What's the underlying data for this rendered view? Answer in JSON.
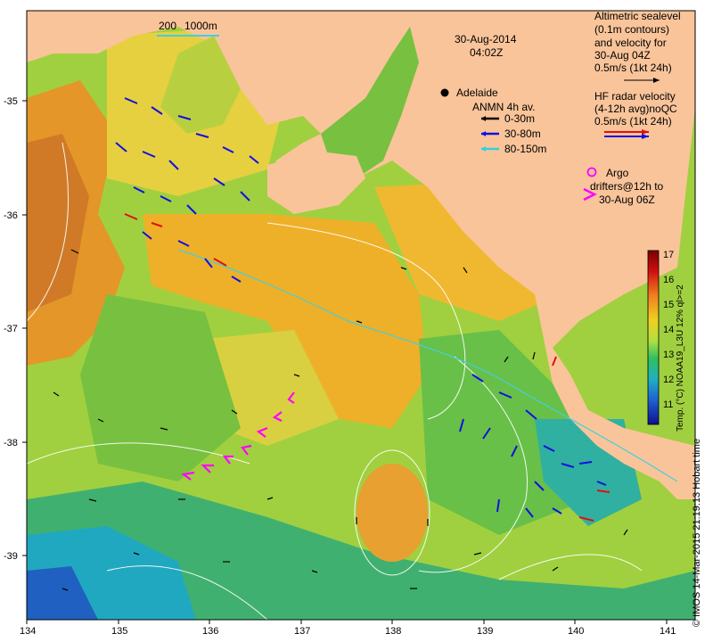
{
  "date": "30-Aug-2014",
  "time": "04:02Z",
  "scale_bar": {
    "label_left": "200",
    "label_right": "1000m"
  },
  "city": {
    "name": "Adelaide"
  },
  "mooring_legend": {
    "title": "ANMN 4h av.",
    "items": [
      {
        "label": "0-30m",
        "color": "#000000"
      },
      {
        "label": "30-80m",
        "color": "#1010e0"
      },
      {
        "label": "80-150m",
        "color": "#30d0e0"
      }
    ]
  },
  "altimetry_legend": {
    "lines": [
      "Altimetric sealevel",
      "(0.1m contours)",
      "and velocity for",
      "30-Aug 04Z",
      "0.5m/s (1kt 24h)"
    ]
  },
  "hf_radar_legend": {
    "lines": [
      "HF radar velocity",
      "(4-12h avg)noQC",
      "0.5m/s (1kt 24h)"
    ]
  },
  "argo_legend": {
    "lines": [
      "Argo",
      "drifters@12h to",
      "30-Aug 06Z"
    ],
    "color": "#ff00ff"
  },
  "colorbar": {
    "title": "Temp. (°C) NOAA19_L3U 12% ql>=2",
    "ticks": [
      "17",
      "16",
      "15",
      "14",
      "13",
      "12",
      "11"
    ]
  },
  "axes": {
    "x_ticks": [
      "134",
      "135",
      "136",
      "137",
      "138",
      "139",
      "140",
      "141"
    ],
    "y_ticks": [
      "-35",
      "-36",
      "-37",
      "-38",
      "-39"
    ]
  },
  "credit": "© IMOS 14-Mar-2015 21:19:13 Hobart time",
  "colors": {
    "land": "#f9c49a",
    "sst_warm": "#e8a020",
    "sst_mid": "#8cc83c",
    "sst_cool": "#20a0c8",
    "hf_red": "#e01010",
    "hf_blue": "#1010e0"
  }
}
